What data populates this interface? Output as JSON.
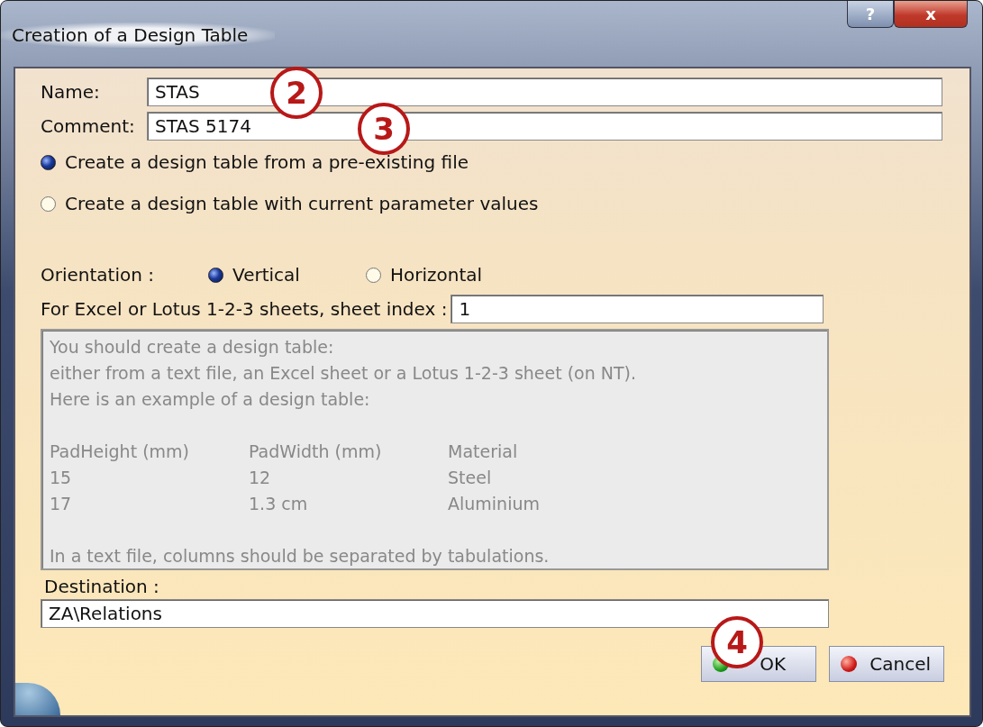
{
  "window": {
    "title": "Creation of a Design Table",
    "buttons": [
      "?",
      "x"
    ]
  },
  "name": {
    "label": "Name:",
    "value": "STAS"
  },
  "comment": {
    "label": "Comment:",
    "value": "STAS 5174"
  },
  "source_options": [
    {
      "label": "Create a design table from a pre-existing file",
      "selected": true
    },
    {
      "label": "Create a design table with current parameter values",
      "selected": false
    }
  ],
  "orientation": {
    "label": "Orientation :",
    "options": [
      {
        "label": "Vertical",
        "selected": true
      },
      {
        "label": "Horizontal",
        "selected": false
      }
    ]
  },
  "sheet_index": {
    "label": "For Excel or Lotus 1-2-3 sheets, sheet index :",
    "value": "1"
  },
  "info": {
    "lines": [
      "You should create a design table:",
      "either from a text file, an Excel sheet or a Lotus 1-2-3 sheet (on NT).",
      "Here is an example of a design table:"
    ],
    "columns": [
      "PadHeight (mm)",
      "PadWidth (mm)",
      "Material"
    ],
    "rows": [
      [
        "15",
        "12",
        "Steel"
      ],
      [
        "17",
        "1.3 cm",
        "Aluminium"
      ]
    ],
    "note": "In a text file, columns should be separated by tabulations."
  },
  "destination": {
    "label": "Destination :",
    "value": "ZA\\Relations"
  },
  "actions": [
    {
      "label": "OK",
      "kind": "ok"
    },
    {
      "label": "Cancel",
      "kind": "cancel"
    }
  ],
  "callouts": [
    "2",
    "3",
    "4"
  ]
}
